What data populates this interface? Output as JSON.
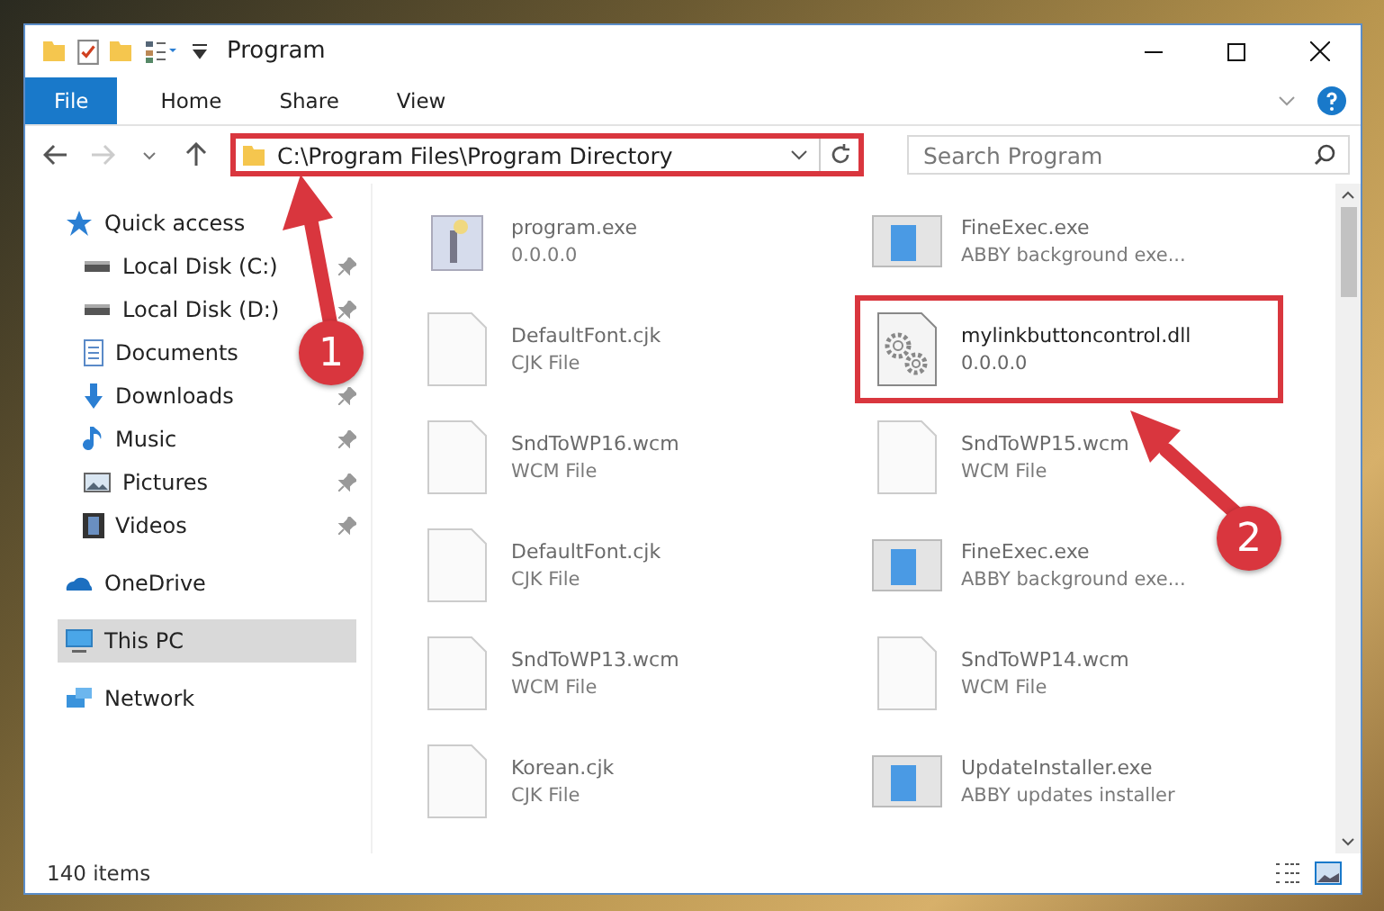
{
  "window": {
    "title": "Program"
  },
  "ribbon_tabs": [
    {
      "label": "File",
      "selected": true
    },
    {
      "label": "Home",
      "selected": false
    },
    {
      "label": "Share",
      "selected": false
    },
    {
      "label": "View",
      "selected": false
    }
  ],
  "address_bar": {
    "path": "C:\\Program Files\\Program Directory",
    "highlighted": true
  },
  "search": {
    "placeholder": "Search Program"
  },
  "sidebar": {
    "items": [
      {
        "label": "Quick access",
        "kind": "star",
        "selected": false,
        "children": [
          {
            "label": "Local Disk (C:)",
            "kind": "drive",
            "pinned": true,
            "selected": false
          },
          {
            "label": "Local Disk (D:)",
            "kind": "drive",
            "pinned": true,
            "selected": false
          },
          {
            "label": "Documents",
            "kind": "documents",
            "pinned": false,
            "selected": false
          },
          {
            "label": "Downloads",
            "kind": "download",
            "pinned": true,
            "selected": false
          },
          {
            "label": "Music",
            "kind": "music",
            "pinned": true,
            "selected": false
          },
          {
            "label": "Pictures",
            "kind": "pictures",
            "pinned": true,
            "selected": false
          },
          {
            "label": "Videos",
            "kind": "videos",
            "pinned": true,
            "selected": false
          }
        ]
      },
      {
        "label": "OneDrive",
        "kind": "cloud",
        "selected": false
      },
      {
        "label": "This PC",
        "kind": "pc",
        "selected": true
      },
      {
        "label": "Network",
        "kind": "network",
        "selected": false
      }
    ]
  },
  "files": [
    {
      "name": "program.exe",
      "detail": "0.0.0.0",
      "kind": "setup",
      "highlighted": false
    },
    {
      "name": "FineExec.exe",
      "detail": "ABBY background exe...",
      "kind": "app",
      "highlighted": false
    },
    {
      "name": "DefaultFont.cjk",
      "detail": "CJK File",
      "kind": "doc",
      "highlighted": false
    },
    {
      "name": "mylinkbuttoncontrol.dll",
      "detail": "0.0.0.0",
      "kind": "dll",
      "highlighted": true
    },
    {
      "name": "SndToWP16.wcm",
      "detail": "WCM File",
      "kind": "doc",
      "highlighted": false
    },
    {
      "name": "SndToWP15.wcm",
      "detail": "WCM File",
      "kind": "doc",
      "highlighted": false
    },
    {
      "name": "DefaultFont.cjk",
      "detail": "CJK File",
      "kind": "doc",
      "highlighted": false
    },
    {
      "name": "FineExec.exe",
      "detail": "ABBY background exe...",
      "kind": "app",
      "highlighted": false
    },
    {
      "name": "SndToWP13.wcm",
      "detail": "WCM File",
      "kind": "doc",
      "highlighted": false
    },
    {
      "name": "SndToWP14.wcm",
      "detail": "WCM File",
      "kind": "doc",
      "highlighted": false
    },
    {
      "name": "Korean.cjk",
      "detail": "CJK File",
      "kind": "doc",
      "highlighted": false
    },
    {
      "name": "UpdateInstaller.exe",
      "detail": "ABBY updates installer",
      "kind": "app",
      "highlighted": false
    }
  ],
  "status_bar": {
    "count": "140 items"
  },
  "annotations": [
    {
      "number": "1"
    },
    {
      "number": "2"
    }
  ]
}
